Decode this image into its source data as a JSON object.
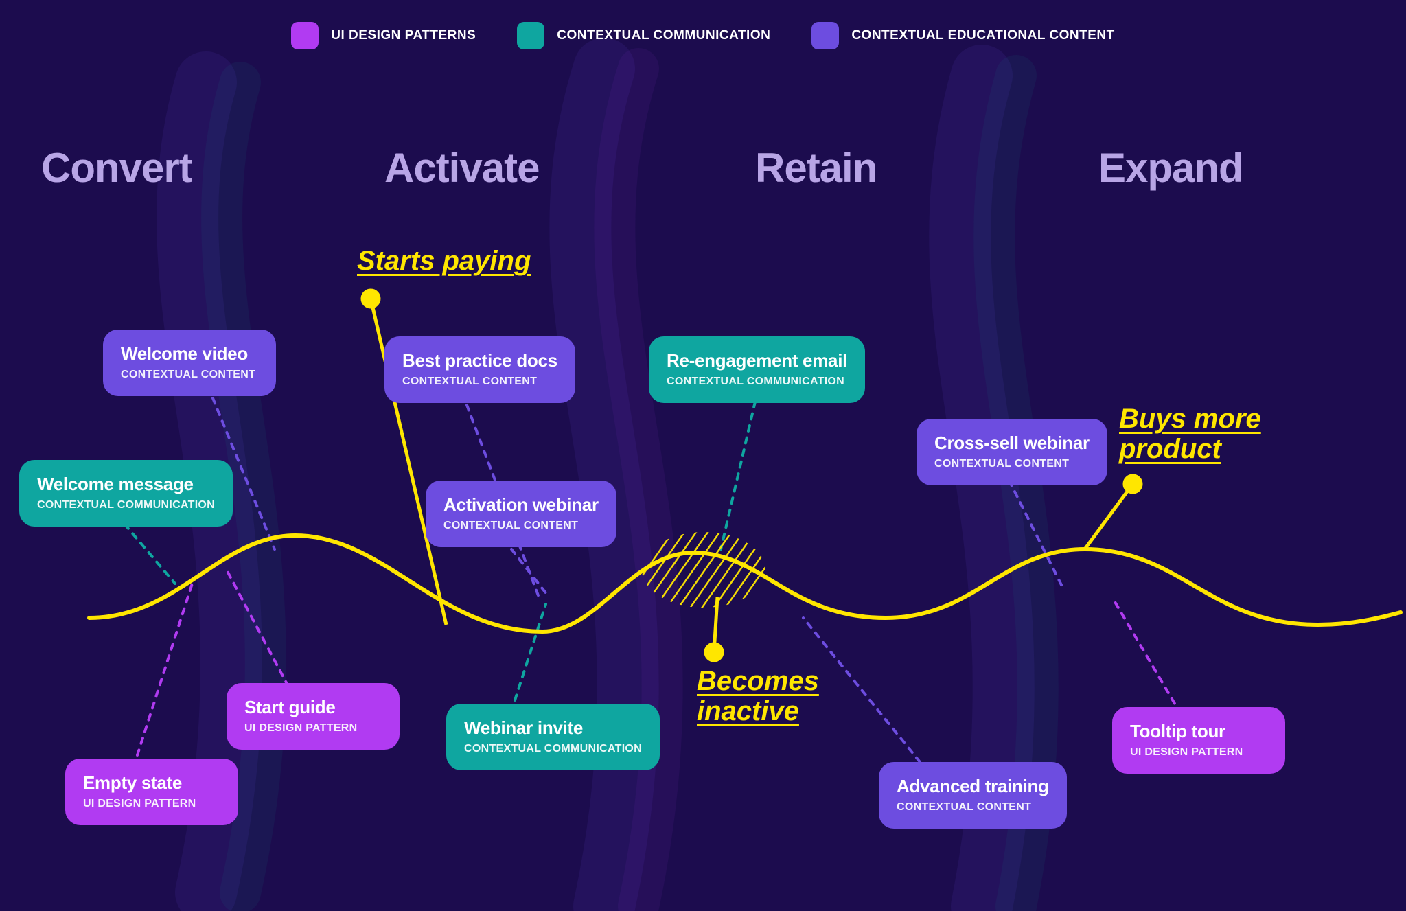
{
  "colors": {
    "ui_pattern": "#b13bf2",
    "communication": "#0fa6a0",
    "content": "#6d4de0",
    "yellow": "#ffe600",
    "heading": "#b8a5e6",
    "bg": "#1c0c4e"
  },
  "legend": [
    {
      "swatch": "#b13bf2",
      "label": "UI DESIGN PATTERNS"
    },
    {
      "swatch": "#0fa6a0",
      "label": "CONTEXTUAL COMMUNICATION"
    },
    {
      "swatch": "#6d4de0",
      "label": "CONTEXTUAL EDUCATIONAL CONTENT"
    }
  ],
  "stages": {
    "convert": "Convert",
    "activate": "Activate",
    "retain": "Retain",
    "expand": "Expand"
  },
  "milestones": {
    "starts_paying": "Starts paying",
    "becomes_inactive": "Becomes\ninactive",
    "buys_more": "Buys more\nproduct"
  },
  "cards": {
    "welcome_video": {
      "title": "Welcome video",
      "sub": "CONTEXTUAL CONTENT",
      "color": "#6d4de0"
    },
    "welcome_message": {
      "title": "Welcome message",
      "sub": "CONTEXTUAL COMMUNICATION",
      "color": "#0fa6a0"
    },
    "start_guide": {
      "title": "Start guide",
      "sub": "UI DESIGN PATTERN",
      "color": "#b13bf2"
    },
    "empty_state": {
      "title": "Empty state",
      "sub": "UI DESIGN PATTERN",
      "color": "#b13bf2"
    },
    "best_practice": {
      "title": "Best practice docs",
      "sub": "CONTEXTUAL CONTENT",
      "color": "#6d4de0"
    },
    "activation_web": {
      "title": "Activation webinar",
      "sub": "CONTEXTUAL CONTENT",
      "color": "#6d4de0"
    },
    "webinar_invite": {
      "title": "Webinar invite",
      "sub": "CONTEXTUAL COMMUNICATION",
      "color": "#0fa6a0"
    },
    "reengagement": {
      "title": "Re-engagement email",
      "sub": "CONTEXTUAL COMMUNICATION",
      "color": "#0fa6a0"
    },
    "advanced_training": {
      "title": "Advanced training",
      "sub": "CONTEXTUAL CONTENT",
      "color": "#6d4de0"
    },
    "cross_sell": {
      "title": "Cross-sell webinar",
      "sub": "CONTEXTUAL CONTENT",
      "color": "#6d4de0"
    },
    "tooltip_tour": {
      "title": "Tooltip tour",
      "sub": "UI DESIGN PATTERN",
      "color": "#b13bf2"
    }
  }
}
